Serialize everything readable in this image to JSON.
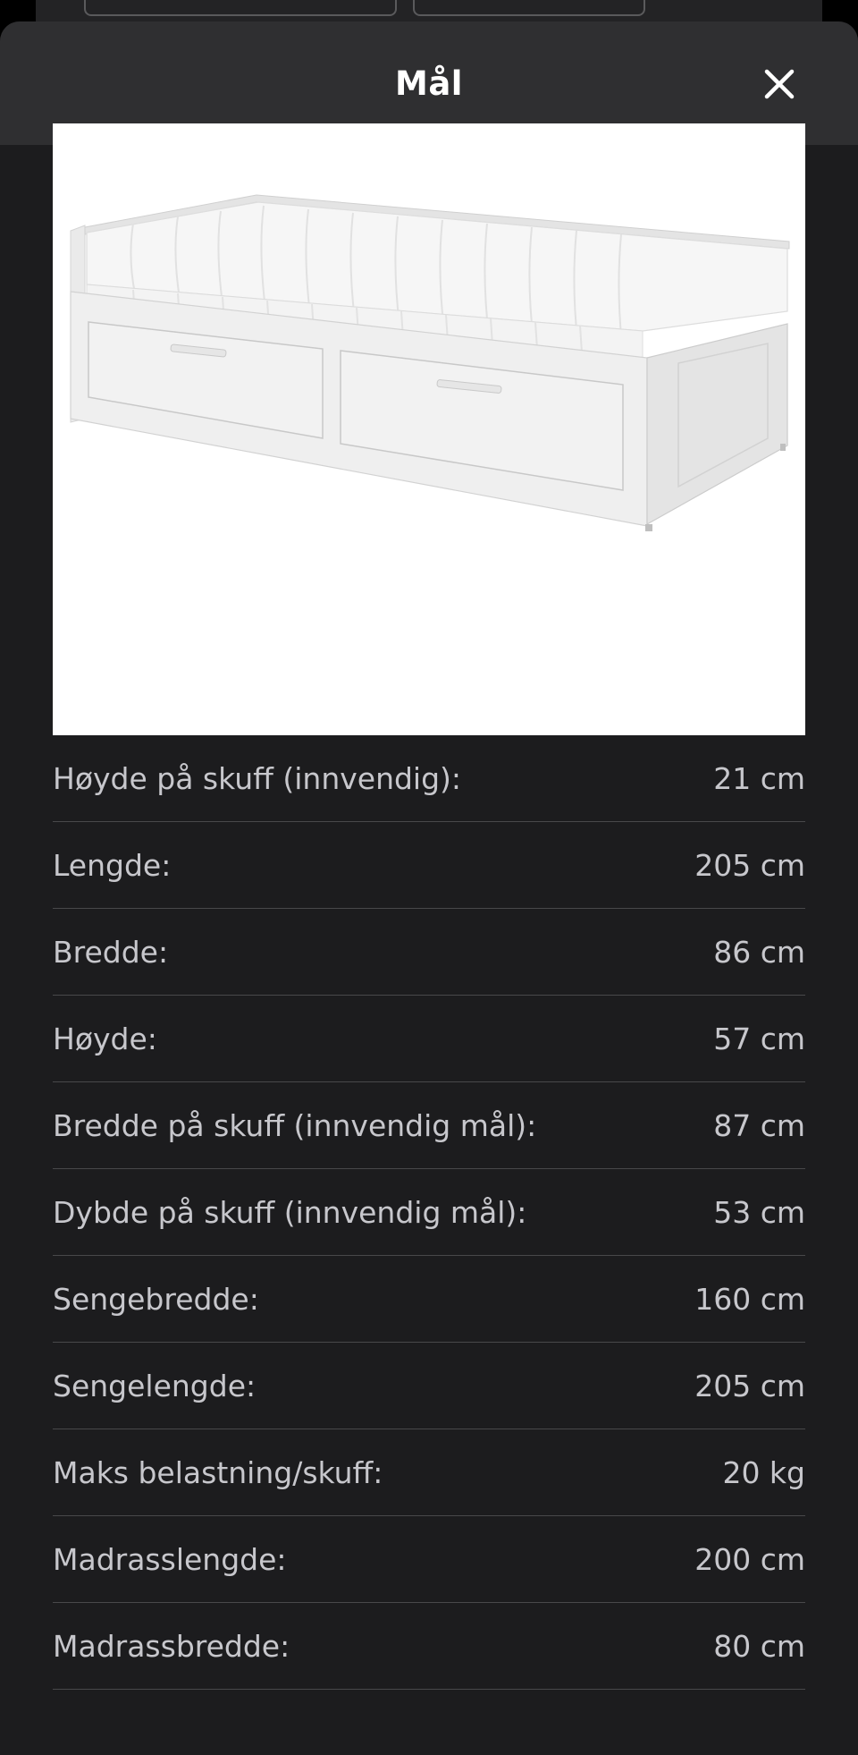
{
  "sheet": {
    "title": "Mål",
    "close_icon": "close-icon"
  },
  "product_image": {
    "alt": "Dagseng med to skuffer og madrasser"
  },
  "specs": [
    {
      "label": "Høyde på skuff (innvendig):",
      "value": "21 cm"
    },
    {
      "label": "Lengde:",
      "value": "205 cm"
    },
    {
      "label": "Bredde:",
      "value": "86 cm"
    },
    {
      "label": "Høyde:",
      "value": "57 cm"
    },
    {
      "label": "Bredde på skuff (innvendig mål):",
      "value": "87 cm"
    },
    {
      "label": "Dybde på skuff (innvendig mål):",
      "value": "53 cm"
    },
    {
      "label": "Sengebredde:",
      "value": "160 cm"
    },
    {
      "label": "Sengelengde:",
      "value": "205 cm"
    },
    {
      "label": "Maks belastning/skuff:",
      "value": "20 kg"
    },
    {
      "label": "Madrasslengde:",
      "value": "200 cm"
    },
    {
      "label": "Madrassbredde:",
      "value": "80 cm"
    }
  ],
  "colors": {
    "sheet_background": "#1c1c1e",
    "header_background": "#2f2f31",
    "text_primary": "#ffffff",
    "text_secondary": "#c7c7cc",
    "divider": "#48484a"
  }
}
